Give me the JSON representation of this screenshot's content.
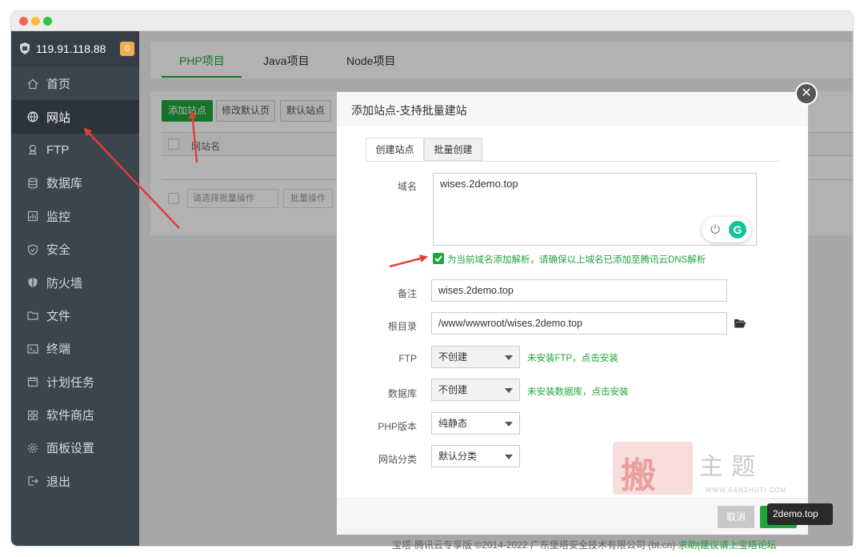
{
  "sidebar": {
    "server_ip": "119.91.118.88",
    "badge_count": "0",
    "items": [
      {
        "label": "首页",
        "icon": "home-icon"
      },
      {
        "label": "网站",
        "icon": "globe-icon"
      },
      {
        "label": "FTP",
        "icon": "ftp-icon"
      },
      {
        "label": "数据库",
        "icon": "database-icon"
      },
      {
        "label": "监控",
        "icon": "monitor-icon"
      },
      {
        "label": "安全",
        "icon": "shield-check-icon"
      },
      {
        "label": "防火墙",
        "icon": "firewall-icon"
      },
      {
        "label": "文件",
        "icon": "folder-icon"
      },
      {
        "label": "终端",
        "icon": "terminal-icon"
      },
      {
        "label": "计划任务",
        "icon": "calendar-icon"
      },
      {
        "label": "软件商店",
        "icon": "apps-icon"
      },
      {
        "label": "面板设置",
        "icon": "gear-icon"
      },
      {
        "label": "退出",
        "icon": "logout-icon"
      }
    ]
  },
  "main": {
    "tabs": [
      "PHP项目",
      "Java项目",
      "Node项目"
    ],
    "toolbar": {
      "add_site": "添加站点",
      "modify_default": "修改默认页",
      "default_site": "默认站点"
    },
    "table": {
      "col_site_name": "网站名"
    },
    "batch_select_placeholder": "请选择批量操作",
    "batch_button": "批量操作"
  },
  "footer": {
    "copyright": "宝塔-腾讯云专享版 ©2014-2022 广东堡塔安全技术有限公司 (bt.cn)",
    "link": "求助|建议请上宝塔论坛"
  },
  "modal": {
    "title": "添加站点-支持批量建站",
    "tabs": [
      "创建站点",
      "批量创建"
    ],
    "fields": {
      "domain_label": "域名",
      "domain_value": "wises.2demo.top",
      "dns_checkbox_label": "为当前域名添加解析，请确保以上域名已添加至腾讯云DNS解析",
      "remark_label": "备注",
      "remark_value": "wises.2demo.top",
      "root_label": "根目录",
      "root_value": "/www/wwwroot/wises.2demo.top",
      "ftp_label": "FTP",
      "ftp_value": "不创建",
      "ftp_hint": "未安装FTP，点击安装",
      "db_label": "数据库",
      "db_value": "不创建",
      "db_hint": "未安装数据库，点击安装",
      "php_label": "PHP版本",
      "php_value": "纯静态",
      "category_label": "网站分类",
      "category_value": "默认分类"
    },
    "cancel": "取消",
    "tooltip": "2demo.top"
  },
  "watermark": {
    "stamp": "搬",
    "title": "主题",
    "url": "WWW.BANZHUTI.COM"
  },
  "colors": {
    "accent_green": "#20a53a",
    "sidebar_bg": "#3c444d",
    "annotation_red": "#e0403a"
  }
}
